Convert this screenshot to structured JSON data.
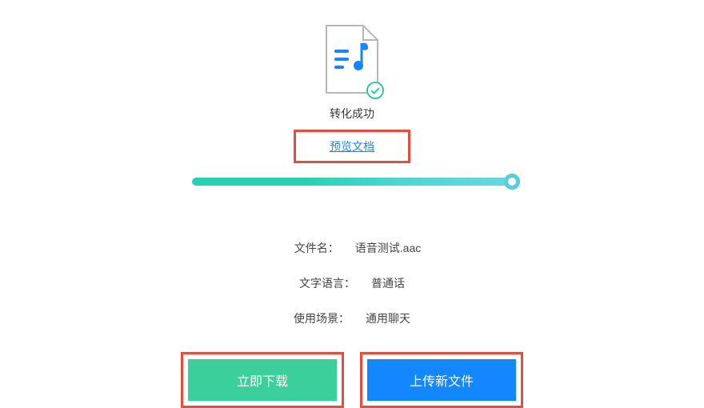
{
  "status": {
    "label": "转化成功",
    "preview_link_label": "预览文档"
  },
  "file": {
    "name_label": "文件名：",
    "name_value": "语音测试.aac",
    "language_label": "文字语言：",
    "language_value": "普通话",
    "scenario_label": "使用场景：",
    "scenario_value": "通用聊天"
  },
  "buttons": {
    "download_label": "立即下载",
    "upload_label": "上传新文件"
  },
  "progress": {
    "percent": 100
  },
  "colors": {
    "accent_green": "#3bcf9b",
    "accent_blue": "#1287ff",
    "highlight_red": "#e74c3c",
    "progress_start": "#24d3b0",
    "progress_end": "#6ad6e6"
  }
}
